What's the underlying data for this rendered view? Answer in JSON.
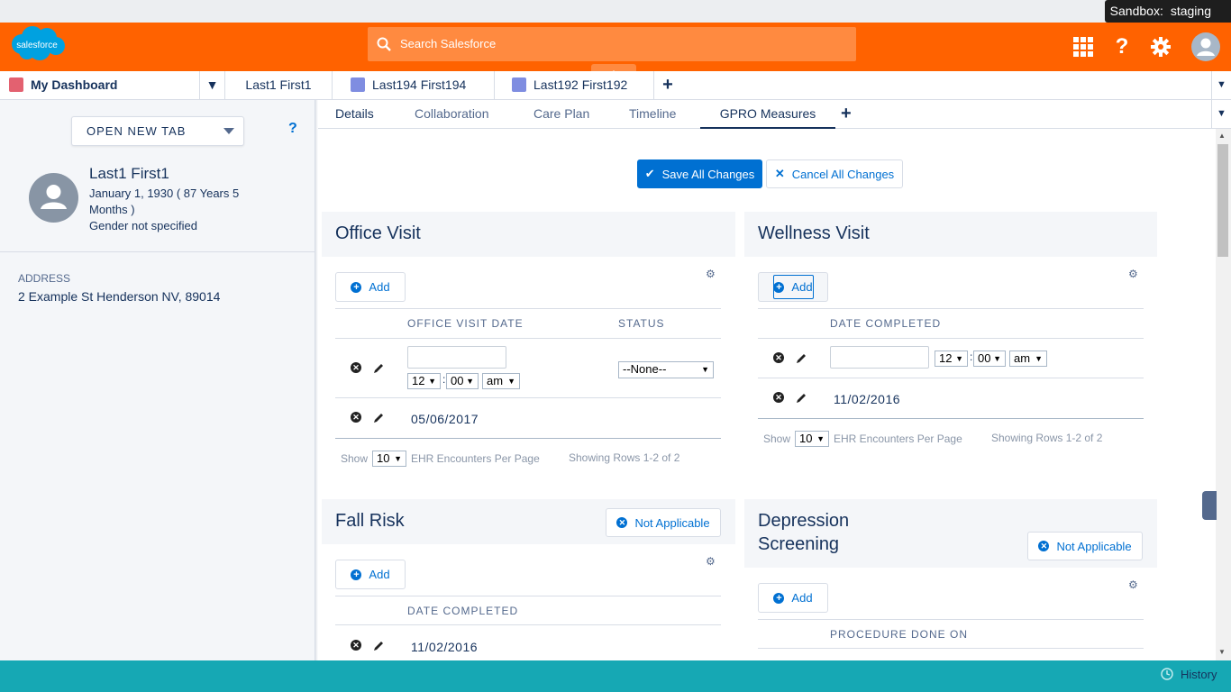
{
  "sandbox": {
    "label": "Sandbox:",
    "name": "staging"
  },
  "header": {
    "logo_text": "salesforce",
    "search_placeholder": "Search Salesforce"
  },
  "tabs": {
    "dashboard": "My Dashboard",
    "items": [
      "Last1 First1",
      "Last194 First194",
      "Last192 First192"
    ]
  },
  "sidebar": {
    "open_new_tab": "OPEN NEW TAB",
    "help": "?",
    "patient_name": "Last1 First1",
    "dob_line1": "January 1, 1930 ( 87 Years 5",
    "dob_line2": "Months )",
    "gender": "Gender not specified",
    "address_label": "ADDRESS",
    "address_value": "2 Example St Henderson NV, 89014"
  },
  "subtabs": [
    "Details",
    "Collaboration",
    "Care Plan",
    "Timeline",
    "GPRO Measures"
  ],
  "actions": {
    "save": "Save All Changes",
    "cancel": "Cancel All Changes"
  },
  "office_visit": {
    "title": "Office Visit",
    "add": "Add",
    "col_date": "OFFICE VISIT DATE",
    "col_status": "STATUS",
    "hour": "12",
    "minute": "00",
    "ampm": "am",
    "status_value": "--None--",
    "row_date": "05/06/2017",
    "show": "Show",
    "per_page": "10",
    "per_page_label": "EHR Encounters Per Page",
    "showing": "Showing Rows 1-2 of 2"
  },
  "wellness_visit": {
    "title": "Wellness Visit",
    "add": "Add",
    "col_date": "DATE COMPLETED",
    "hour": "12",
    "minute": "00",
    "ampm": "am",
    "row_date": "11/02/2016",
    "show": "Show",
    "per_page": "10",
    "per_page_label": "EHR Encounters Per Page",
    "showing": "Showing Rows 1-2 of 2"
  },
  "fall_risk": {
    "title": "Fall Risk",
    "not_applicable": "Not Applicable",
    "add": "Add",
    "col_date": "DATE COMPLETED",
    "row_date": "11/02/2016"
  },
  "depression": {
    "title_line1": "Depression",
    "title_line2": "Screening",
    "not_applicable": "Not Applicable",
    "add": "Add",
    "col_date": "PROCEDURE DONE ON"
  },
  "footer": {
    "history": "History"
  },
  "colors": {
    "header": "#ff6200",
    "footer": "#16a8b4",
    "brand_blue": "#0070d2",
    "text": "#16325c"
  }
}
